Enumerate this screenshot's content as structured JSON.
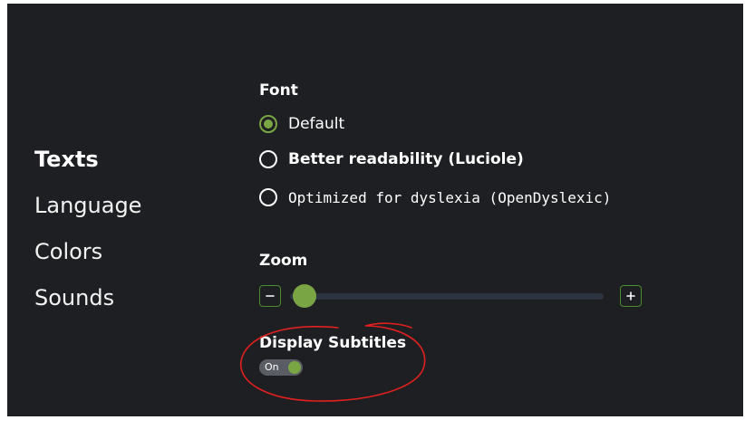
{
  "sidebar": {
    "items": [
      {
        "label": "Texts",
        "active": true
      },
      {
        "label": "Language",
        "active": false
      },
      {
        "label": "Colors",
        "active": false
      },
      {
        "label": "Sounds",
        "active": false
      }
    ]
  },
  "font_section": {
    "heading": "Font",
    "options": [
      {
        "label": "Default",
        "selected": true
      },
      {
        "label": "Better readability (Luciole)",
        "selected": false
      },
      {
        "label": "Optimized for dyslexia (OpenDyslexic)",
        "selected": false
      }
    ]
  },
  "zoom_section": {
    "heading": "Zoom",
    "level_fraction": 0.0
  },
  "subtitles_section": {
    "heading": "Display Subtitles",
    "toggle_label": "On",
    "toggle_on": true
  },
  "colors": {
    "background": "#1e1f22",
    "accent": "#7aa545",
    "annotation": "#e02020"
  },
  "icons": {
    "zoom_out": "minus-icon",
    "zoom_in": "plus-icon"
  }
}
